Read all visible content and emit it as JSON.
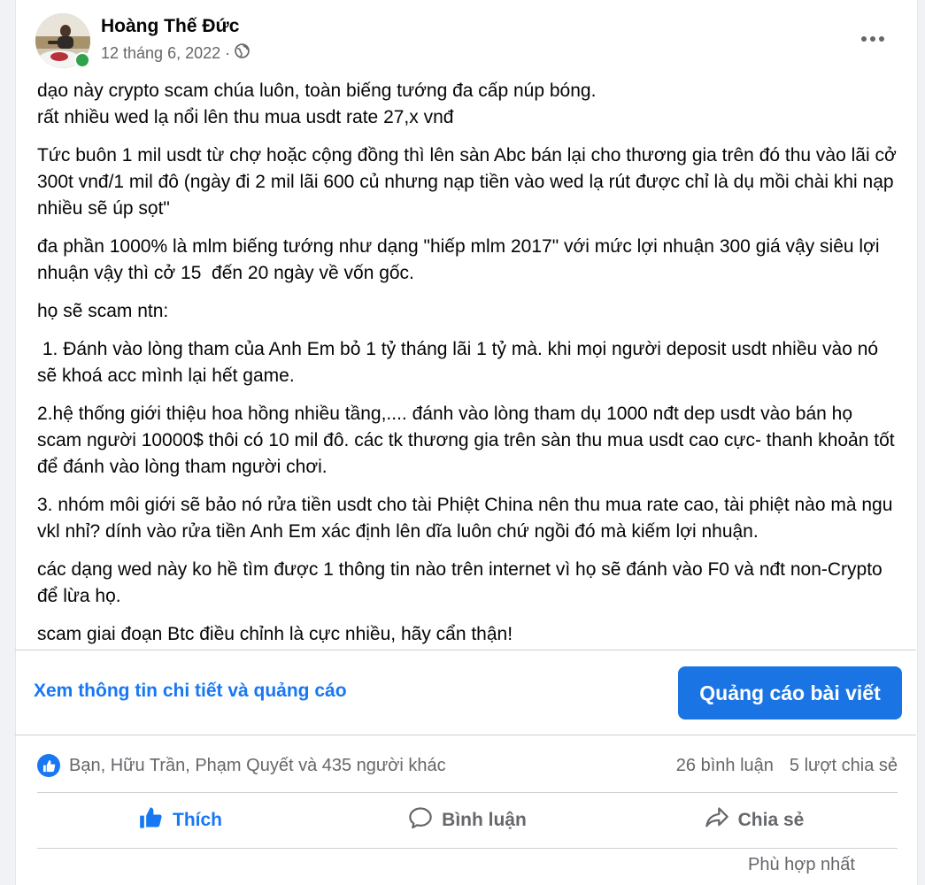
{
  "post": {
    "author": "Hoàng Thế Đức",
    "date": "12 tháng 6, 2022",
    "separator": "·",
    "paragraphs": [
      "dạo này crypto scam chúa luôn, toàn biếng tướng đa cấp núp bóng.\nrất nhiều wed lạ nổi lên thu mua usdt rate 27,x vnđ",
      "Tức buôn 1 mil usdt từ chợ hoặc cộng đồng thì lên sàn Abc bán lại cho thương gia trên đó thu vào lãi cở 300t vnđ/1 mil đô (ngày đi 2 mil lãi 600 củ nhưng nạp tiền vào wed lạ rút được chỉ là dụ mồi chài khi nạp nhiều sẽ úp sọt\"",
      "đa phần 1000% là mlm biếng tướng như dạng \"hiếp mlm 2017\" với mức lợi nhuận 300 giá vậy siêu lợi nhuận vậy thì cở 15  đến 20 ngày về vốn gốc.",
      "họ sẽ scam ntn:",
      " 1. Đánh vào lòng tham của Anh Em bỏ 1 tỷ tháng lãi 1 tỷ mà. khi mọi người deposit usdt nhiều vào nó sẽ khoá acc mình lại hết game.",
      "2.hệ thống giới thiệu hoa hồng nhiều tầng,.... đánh vào lòng tham dụ 1000 nđt dep usdt vào bán họ scam người 10000$ thôi có 10 mil đô. các tk thương gia trên sàn thu mua usdt cao cực- thanh khoản tốt để đánh vào lòng tham người chơi.",
      "3. nhóm môi giới sẽ bảo nó rửa tiền usdt cho tài Phiệt China nên thu mua rate cao, tài phiệt nào mà ngu vkl nhỉ? dính vào rửa tiền Anh Em xác định lên dĩa luôn chứ ngồi đó mà kiếm lợi nhuận.",
      "các dạng wed này ko hề tìm được 1 thông tin nào trên internet vì họ sẽ đánh vào F0 và nđt non-Crypto để lừa họ.",
      "scam giai đoạn Btc điều chỉnh là cực nhiều, hãy cẩn thận!"
    ]
  },
  "promote": {
    "insights_link": "Xem thông tin chi tiết và quảng cáo",
    "boost_button": "Quảng cáo bài viết"
  },
  "summary": {
    "reactions_text": "Bạn, Hữu Trần, Phạm Quyết và 435 người khác",
    "comments": "26 bình luận",
    "shares": "5 lượt chia sẻ"
  },
  "actions": {
    "like": "Thích",
    "comment": "Bình luận",
    "share": "Chia sẻ"
  },
  "cut_off_text": "Phù hợp nhất",
  "colors": {
    "accent": "#1877f2",
    "button": "#1b74e4",
    "secondary_text": "#65676b",
    "online": "#31a24c"
  },
  "icons": [
    "globe-icon",
    "more-options-icon",
    "like-reaction-icon",
    "like-icon",
    "comment-icon",
    "share-icon"
  ]
}
